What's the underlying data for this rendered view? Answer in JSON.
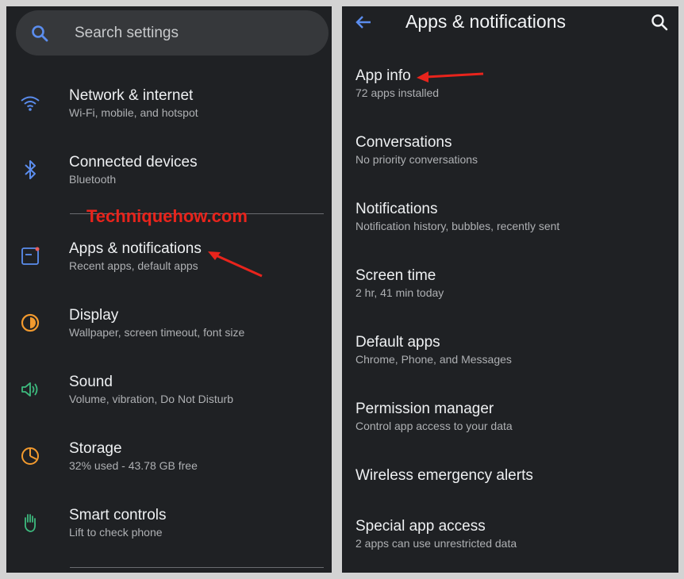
{
  "left": {
    "search": {
      "placeholder": "Search settings"
    },
    "items": [
      {
        "title": "Network & internet",
        "subtitle": "Wi-Fi, mobile, and hotspot",
        "icon": "wifi-icon"
      },
      {
        "title": "Connected devices",
        "subtitle": "Bluetooth",
        "icon": "bluetooth-icon"
      },
      {
        "title": "Apps & notifications",
        "subtitle": "Recent apps, default apps",
        "icon": "apps-icon"
      },
      {
        "title": "Display",
        "subtitle": "Wallpaper, screen timeout, font size",
        "icon": "brightness-icon"
      },
      {
        "title": "Sound",
        "subtitle": "Volume, vibration, Do Not Disturb",
        "icon": "volume-icon"
      },
      {
        "title": "Storage",
        "subtitle": "32% used - 43.78 GB free",
        "icon": "storage-icon"
      },
      {
        "title": "Smart controls",
        "subtitle": "Lift to check phone",
        "icon": "hand-gesture-icon"
      }
    ],
    "watermark": "Techniquehow.com"
  },
  "right": {
    "header": {
      "title": "Apps & notifications"
    },
    "items": [
      {
        "title": "App info",
        "subtitle": "72 apps installed"
      },
      {
        "title": "Conversations",
        "subtitle": "No priority conversations"
      },
      {
        "title": "Notifications",
        "subtitle": "Notification history, bubbles, recently sent"
      },
      {
        "title": "Screen time",
        "subtitle": "2 hr, 41 min today"
      },
      {
        "title": "Default apps",
        "subtitle": "Chrome, Phone, and Messages"
      },
      {
        "title": "Permission manager",
        "subtitle": "Control app access to your data"
      },
      {
        "title": "Wireless emergency alerts"
      },
      {
        "title": "Special app access",
        "subtitle": "2 apps can use unrestricted data"
      }
    ]
  },
  "colors": {
    "panel_background": "#1f2124",
    "search_background": "#36383b",
    "accent_blue": "#5b8dee",
    "annotation_red": "#e8241c"
  }
}
